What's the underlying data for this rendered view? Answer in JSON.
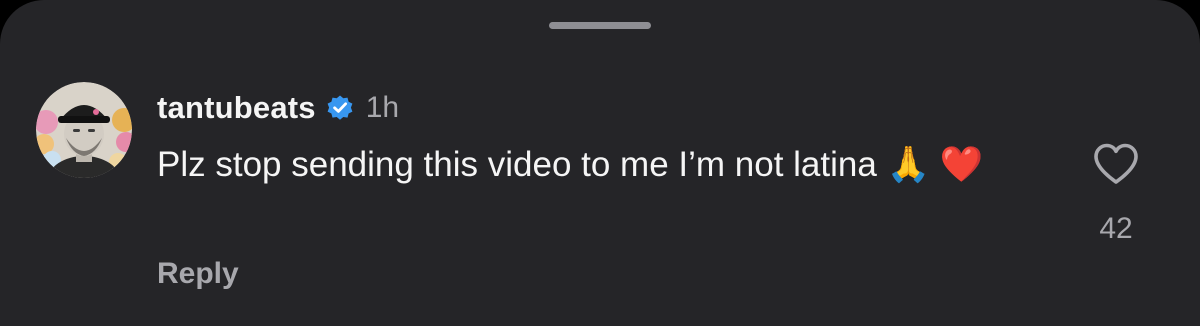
{
  "comment": {
    "username": "tantubeats",
    "verified": true,
    "time": "1h",
    "text": "Plz stop sending this video to me I’m not latina 🙏 ❤️",
    "reply_label": "Reply",
    "like_count": "42",
    "like_icon": "heart-outline-icon",
    "verified_icon": "verified-badge-icon"
  },
  "colors": {
    "background": "#252528",
    "text_primary": "#f5f5f5",
    "text_secondary": "#a8a8ad",
    "verified_badge": "#3897f0",
    "grabber": "#8e8e93"
  }
}
